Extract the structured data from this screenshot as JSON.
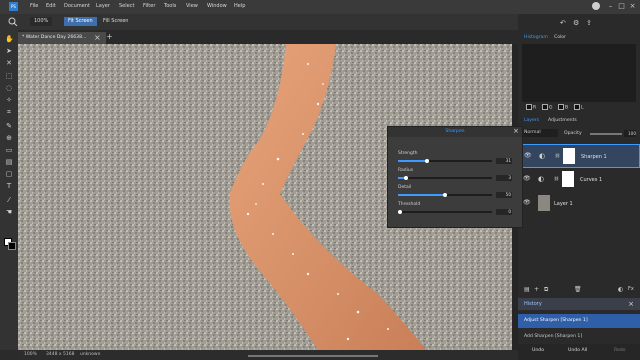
{
  "app": {
    "logo_text": "PS"
  },
  "menu": [
    "File",
    "Edit",
    "Document",
    "Layer",
    "Select",
    "Filter",
    "Tools",
    "View",
    "Window",
    "Help"
  ],
  "window_buttons": {
    "minimize": "–",
    "maximize": "□",
    "close": "×"
  },
  "options_bar": {
    "zoom_label": "100%",
    "fit_screen": "Fit Screen",
    "fill_screen": "Fill Screen"
  },
  "document": {
    "tab_title": "* Water Dance Day 26638...",
    "tab_close": "×",
    "tab_add": "+"
  },
  "status": {
    "zoom": "100%",
    "dimensions": "3448 x 5168",
    "profile": "unknown"
  },
  "right_panel": {
    "top_tabs": [
      "Histogram",
      "Color"
    ],
    "channels": [
      "R",
      "G",
      "B",
      "L"
    ],
    "layer_tabs": [
      "Layers",
      "Adjustments"
    ],
    "blend_mode": "Normal",
    "opacity_label": "Opacity",
    "opacity_value": "100",
    "layers": [
      {
        "name": "Sharpen 1"
      },
      {
        "name": "Curves 1"
      },
      {
        "name": "Layer 1"
      }
    ]
  },
  "sharpen_dialog": {
    "title": "Sharpen",
    "close": "×",
    "sliders": [
      {
        "label": "Strength",
        "value": "31",
        "fraction": 0.31
      },
      {
        "label": "Radius",
        "value": "3",
        "fraction": 0.08
      },
      {
        "label": "Detail",
        "value": "50",
        "fraction": 0.5
      },
      {
        "label": "Threshold",
        "value": "0",
        "fraction": 0.02
      }
    ]
  },
  "history": {
    "title": "History",
    "close": "×",
    "items": [
      {
        "label": "Adjust Sharpen [Sharpen 1]",
        "selected": true
      },
      {
        "label": "Add Sharpen [Sharpen 1]",
        "selected": false
      }
    ],
    "undo": "Undo",
    "undo_all": "Undo All",
    "redo": "Redo"
  },
  "colors": {
    "accent": "#3d9bff",
    "selection": "#2f5fa8"
  }
}
